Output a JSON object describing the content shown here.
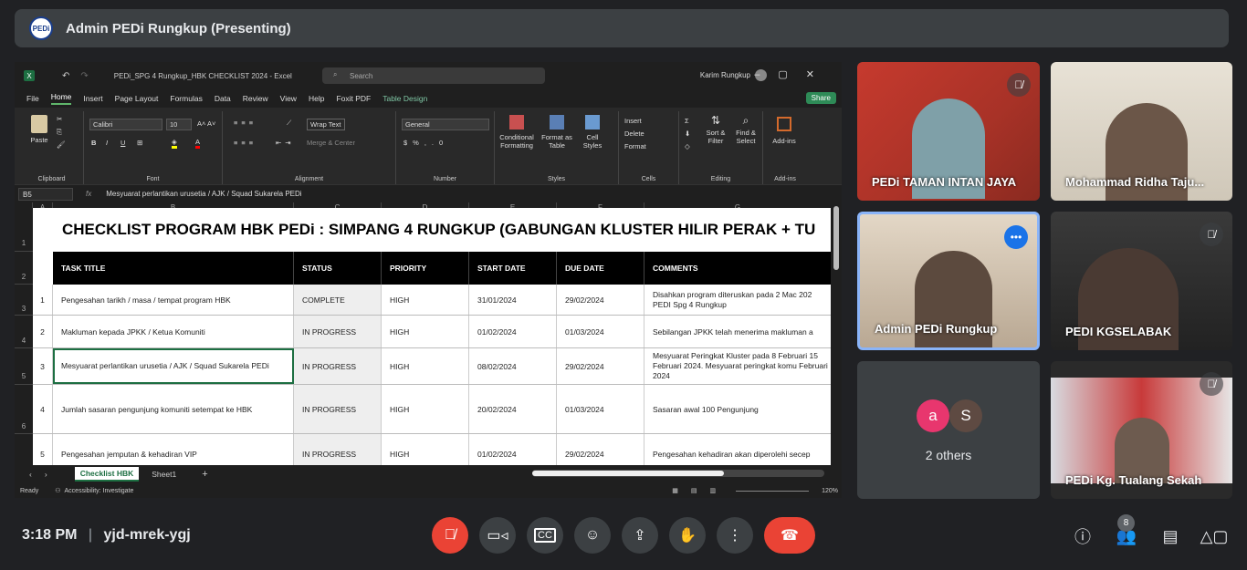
{
  "meeting": {
    "logo_text": "PEDi",
    "title": "Admin PEDi Rungkup (Presenting)",
    "time": "3:18 PM",
    "separator": "|",
    "code": "yjd-mrek-ygj",
    "participant_count": "8"
  },
  "excel": {
    "file_title": "PEDi_SPG 4 Rungkup_HBK CHECKLIST 2024  -  Excel",
    "search_placeholder": "Search",
    "user": "Karim Rungkup",
    "menu": [
      "File",
      "Home",
      "Insert",
      "Page Layout",
      "Formulas",
      "Data",
      "Review",
      "View",
      "Help",
      "Foxit PDF",
      "Table Design"
    ],
    "share_label": "Share",
    "ribbon": {
      "font_name": "Calibri",
      "font_size": "10",
      "wrap_text": "Wrap Text",
      "merge_center": "Merge & Center",
      "number_format": "General",
      "paste": "Paste",
      "conditional_formatting": "Conditional Formatting",
      "format_as_table": "Format as Table",
      "cell_styles": "Cell Styles",
      "insert": "Insert",
      "delete": "Delete",
      "format": "Format",
      "sort_filter": "Sort & Filter",
      "find_select": "Find & Select",
      "addins": "Add-ins",
      "groups": [
        "Clipboard",
        "Font",
        "Alignment",
        "Number",
        "Styles",
        "Cells",
        "Editing",
        "Add-ins"
      ]
    },
    "name_box": "B5",
    "fx_label": "fx",
    "formula_value": "Mesyuarat perlantikan urusetia / AJK / Squad Sukarela PEDi",
    "columns": [
      "A",
      "B",
      "C",
      "D",
      "E",
      "F",
      "G"
    ],
    "row_numbers": [
      "1",
      "2",
      "3",
      "4",
      "5",
      "6"
    ],
    "sheet_title": "CHECKLIST PROGRAM HBK PEDi : SIMPANG 4 RUNGKUP (GABUNGAN KLUSTER HILIR PERAK + TU",
    "table_headers": [
      "TASK TITLE",
      "STATUS",
      "PRIORITY",
      "START DATE",
      "DUE DATE",
      "COMMENTS"
    ],
    "rows": [
      {
        "no": "1",
        "task": "Pengesahan tarikh / masa / tempat program HBK",
        "status": "COMPLETE",
        "priority": "HIGH",
        "start": "31/01/2024",
        "due": "29/02/2024",
        "comments": "Disahkan program diteruskan pada 2 Mac 202 PEDI Spg 4 Rungkup"
      },
      {
        "no": "2",
        "task": "Makluman kepada JPKK / Ketua Komuniti",
        "status": "IN PROGRESS",
        "priority": "HIGH",
        "start": "01/02/2024",
        "due": "01/03/2024",
        "comments": "Sebilangan JPKK telah menerima makluman a"
      },
      {
        "no": "3",
        "task": "Mesyuarat perlantikan urusetia / AJK / Squad Sukarela PEDi",
        "status": "IN PROGRESS",
        "priority": "HIGH",
        "start": "08/02/2024",
        "due": "29/02/2024",
        "comments": "Mesyuarat Peringkat Kluster pada 8 Februari 15 Februari 2024. Mesyuarat peringkat komu Februari 2024"
      },
      {
        "no": "4",
        "task": "Jumlah sasaran pengunjung komuniti setempat ke HBK",
        "status": "IN PROGRESS",
        "priority": "HIGH",
        "start": "20/02/2024",
        "due": "01/03/2024",
        "comments": "Sasaran awal 100 Pengunjung"
      },
      {
        "no": "5",
        "task": "Pengesahan jemputan & kehadiran VIP",
        "status": "IN PROGRESS",
        "priority": "HIGH",
        "start": "01/02/2024",
        "due": "29/02/2024",
        "comments": "Pengesahan kehadiran akan diperolehi secep"
      }
    ],
    "sheet_tabs": [
      "Checklist HBK",
      "Sheet1"
    ],
    "add_sheet": "+",
    "status_ready": "Ready",
    "status_accessibility": "Accessibility: Investigate",
    "zoom": "120%"
  },
  "participants": [
    {
      "name": "PEDi TAMAN INTAN JAYA",
      "muted": true
    },
    {
      "name": "Mohammad Ridha Taju...",
      "muted": false
    },
    {
      "name": "Admin PEDi Rungkup",
      "muted": false,
      "speaking": true
    },
    {
      "name": "PEDI KGSELABAK",
      "muted": true
    },
    {
      "name": "PEDi Kg. Tualang Sekah",
      "muted": true
    }
  ],
  "others": {
    "label": "2 others",
    "avatars": [
      "a",
      "S"
    ]
  },
  "colors": {
    "accent": "#8ab4f8",
    "end_call": "#ea4335",
    "excel_green": "#1d6f42"
  }
}
